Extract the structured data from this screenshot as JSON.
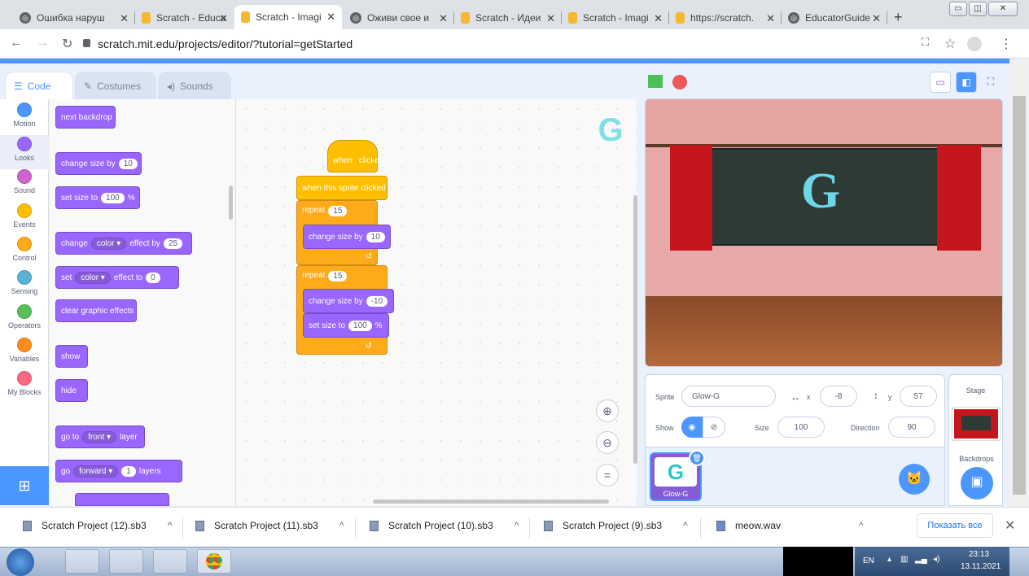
{
  "browser": {
    "tabs": [
      {
        "label": "Ошибка наруш",
        "icon": "globe-icon",
        "active": false
      },
      {
        "label": "Scratch - Educa",
        "icon": "scratch-icon",
        "active": false
      },
      {
        "label": "Scratch - Imagi",
        "icon": "scratch-icon",
        "active": true
      },
      {
        "label": "Оживи свое и",
        "icon": "globe-icon",
        "active": false
      },
      {
        "label": "Scratch - Идеи",
        "icon": "scratch-icon",
        "active": false
      },
      {
        "label": "Scratch - Imagi",
        "icon": "scratch-icon",
        "active": false
      },
      {
        "label": "https://scratch.",
        "icon": "scratch-icon",
        "active": false
      },
      {
        "label": "EducatorGuide",
        "icon": "globe-icon",
        "active": false
      }
    ],
    "url": "scratch.mit.edu/projects/editor/?tutorial=getStarted"
  },
  "editor_tabs": {
    "code": "Code",
    "costumes": "Costumes",
    "sounds": "Sounds"
  },
  "categories": [
    {
      "label": "Motion",
      "color": "#4c97ff"
    },
    {
      "label": "Looks",
      "color": "#9966ff"
    },
    {
      "label": "Sound",
      "color": "#cf63cf"
    },
    {
      "label": "Events",
      "color": "#ffbf00"
    },
    {
      "label": "Control",
      "color": "#ffab19"
    },
    {
      "label": "Sensing",
      "color": "#5cb1d6"
    },
    {
      "label": "Operators",
      "color": "#59c059"
    },
    {
      "label": "Variables",
      "color": "#ff8c1a"
    },
    {
      "label": "My Blocks",
      "color": "#ff6680"
    }
  ],
  "palette": {
    "next_backdrop": "next backdrop",
    "change_size_by": "change size by",
    "change_size_val": "10",
    "set_size_to": "set size to",
    "set_size_val": "100",
    "percent": "%",
    "change": "change",
    "color_drop": "color",
    "effect_by": "effect by",
    "effect_by_val": "25",
    "set": "set",
    "effect_to": "effect to",
    "effect_to_val": "0",
    "clear_effects": "clear graphic effects",
    "show": "show",
    "hide": "hide",
    "go_to": "go to",
    "front_drop": "front",
    "layer": "layer",
    "go": "go",
    "forward_drop": "forward",
    "layers_val": "1",
    "layers": "layers"
  },
  "script": {
    "when": "when",
    "clicked": "clicked",
    "when_sprite_clicked": "when this sprite clicked",
    "repeat": "repeat",
    "repeat1_val": "15",
    "change_size_by": "change size by",
    "change1_val": "10",
    "repeat2_val": "15",
    "change2_val": "-10",
    "set_size_to": "set size to",
    "set_val": "100",
    "percent": "%",
    "loop_arrow": "↺"
  },
  "sprite_letter": "G",
  "sprite_info": {
    "sprite_label": "Sprite",
    "sprite_name": "Glow-G",
    "x_label": "x",
    "x_value": "-8",
    "y_label": "y",
    "y_value": "57",
    "show_label": "Show",
    "size_label": "Size",
    "size_value": "100",
    "direction_label": "Direction",
    "direction_value": "90"
  },
  "sprite_tile_name": "Glow-G",
  "stage_panel": {
    "title": "Stage",
    "backdrops": "Backdrops"
  },
  "downloads": [
    {
      "name": "Scratch Project (12).sb3"
    },
    {
      "name": "Scratch Project (11).sb3"
    },
    {
      "name": "Scratch Project (10).sb3"
    },
    {
      "name": "Scratch Project (9).sb3"
    },
    {
      "name": "meow.wav"
    }
  ],
  "show_all": "Показать все",
  "tray": {
    "lang": "EN",
    "time": "23:13",
    "date": "13.11.2021"
  }
}
